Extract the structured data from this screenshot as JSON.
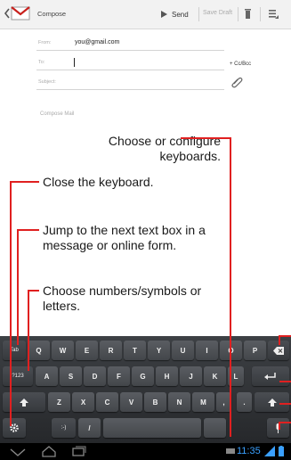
{
  "app_bar": {
    "title": "Compose",
    "send_label": "Send",
    "save_draft_label": "Save Draft"
  },
  "compose": {
    "from_label": "From:",
    "from_value": "you@gmail.com",
    "to_label": "To:",
    "cc_bcc_label": "+ Cc/Bcc",
    "subject_label": "Subject:",
    "body_placeholder": "Compose Mail"
  },
  "callouts": {
    "configure": "Choose or configure keyboards.",
    "close": "Close the keyboard.",
    "jump": "Jump to the next text box in a message or online form.",
    "numbers": "Choose numbers/symbols or letters."
  },
  "keyboard": {
    "row1": [
      "Q",
      "W",
      "E",
      "R",
      "T",
      "Y",
      "U",
      "I",
      "O",
      "P"
    ],
    "row2": [
      "A",
      "S",
      "D",
      "F",
      "G",
      "H",
      "J",
      "K",
      "L"
    ],
    "row3": [
      "Z",
      "X",
      "C",
      "V",
      "B",
      "N",
      "M",
      ",",
      "."
    ],
    "tab_label": "Tab",
    "sym_label": "?123",
    "smiley_label": ":-)",
    "slash_label": "/"
  },
  "status_bar": {
    "time": "11:35"
  },
  "colors": {
    "accent": "#3aa0ff",
    "callout_line": "#e02020",
    "mail_icon": "#c8201c"
  }
}
